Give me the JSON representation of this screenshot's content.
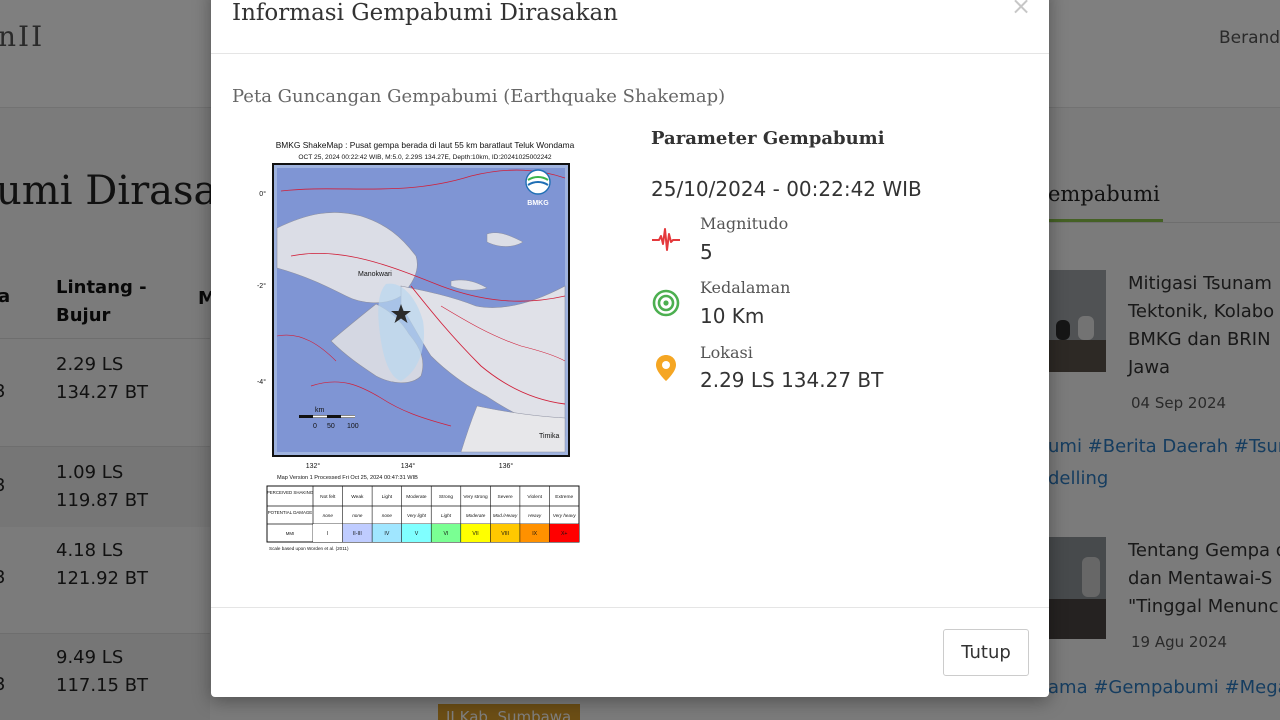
{
  "background": {
    "logo_fragment": "nII",
    "nav_item": "Berand",
    "page_title_fragment": "umi Dirasak",
    "table": {
      "col_left_fragment": "a",
      "col_coord": "Lintang - Bujur",
      "col_next_fragment": "M",
      "rows": [
        {
          "num": "3",
          "lat": "2.29 LS",
          "lon": "134.27 BT"
        },
        {
          "num": "3",
          "lat": "1.09 LS",
          "lon": "119.87 BT"
        },
        {
          "num": "3",
          "lat": "4.18 LS",
          "lon": "121.92 BT"
        },
        {
          "num": "3",
          "lat": "9.49 LS",
          "lon": "117.15 BT"
        }
      ],
      "badge_fragment": "II Kab. Sumbawa"
    },
    "right_panel": {
      "tab_label": "empabumi",
      "news": [
        {
          "title_lines": [
            "Mitigasi Tsunam",
            "Tektonik, Kolabo",
            "BMKG dan BRIN",
            "Jawa"
          ],
          "date": "04 Sep 2024"
        },
        {
          "title_lines": [
            "Tentang Gempa d",
            "dan Mentawai-S",
            "\"Tinggal Menunc"
          ],
          "date": "19 Agu 2024"
        }
      ],
      "tags_1": [
        "umi #Berita Daerah #Tsuna",
        "delling"
      ],
      "tags_2": "ama #Gempabumi #Mega"
    }
  },
  "modal": {
    "title": "Informasi Gempabumi Dirasakan",
    "close_symbol": "×",
    "section_title": "Peta Guncangan Gempabumi (Earthquake Shakemap)",
    "shakemap": {
      "heading": "BMKG ShakeMap : Pusat gempa berada di laut 55 km baratlaut Teluk Wondama",
      "subheading": "OCT 25, 2024 00:22:42 WIB, M:5.0, 2.29S 134.27E, Depth:10km, ID:20241025002242",
      "logo_text": "BMKG",
      "map_labels": [
        "Manokwari",
        "Timika"
      ],
      "lat_ticks": [
        "0°",
        "-2°",
        "-4°"
      ],
      "lon_ticks": [
        "132°",
        "134°",
        "136°"
      ],
      "scale_unit": "km",
      "scale_ticks": [
        "0",
        "50",
        "100"
      ],
      "version_text": "Map Version 1 Processed Fri Oct 25, 2024 00:47:31 WIB",
      "legend_rows": {
        "shaking_label": "PERCEIVED SHAKING",
        "damage_label": "POTENTIAL DAMAGE",
        "mmi_label": "MMI",
        "shaking": [
          "Not felt",
          "Weak",
          "Light",
          "Moderate",
          "Strong",
          "Very strong",
          "Severe",
          "Violent",
          "Extreme"
        ],
        "damage": [
          "none",
          "none",
          "none",
          "Very light",
          "Light",
          "Moderate",
          "Mod./Heavy",
          "Heavy",
          "Very heavy"
        ],
        "mmi": [
          "I",
          "II-III",
          "IV",
          "V",
          "VI",
          "VII",
          "VIII",
          "IX",
          "X+"
        ],
        "colors": [
          "#ffffff",
          "#bfccff",
          "#a0e6ff",
          "#80ffff",
          "#7aff93",
          "#ffff00",
          "#ffc800",
          "#ff9100",
          "#ff0000"
        ]
      },
      "footnote": "Scale based upon Worden et al. (2011)"
    },
    "parameters": {
      "title": "Parameter Gempabumi",
      "datetime": "25/10/2024 - 00:22:42 WIB",
      "magnitude_label": "Magnitudo",
      "magnitude_value": "5",
      "depth_label": "Kedalaman",
      "depth_value": "10 Km",
      "location_label": "Lokasi",
      "location_value": "2.29 LS 134.27 BT"
    },
    "footer_button": "Tutup"
  },
  "colors": {
    "magnitude_icon": "#e4393c",
    "depth_icon": "#4caf50",
    "location_icon": "#f5a623",
    "tag_link": "#2c7bc0",
    "tab_underline": "#8bc34a"
  }
}
